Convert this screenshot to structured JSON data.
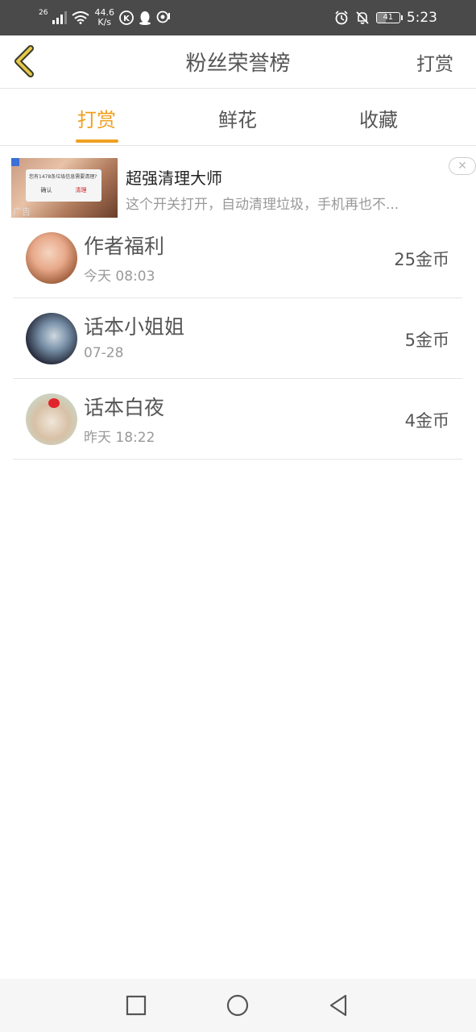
{
  "status_bar": {
    "network_type": "26",
    "speed_value": "44.6",
    "speed_unit": "K/s",
    "battery": "41",
    "time": "5:23"
  },
  "header": {
    "title": "粉丝荣誉榜",
    "right_action": "打赏"
  },
  "tabs": [
    {
      "label": "打赏",
      "active": true
    },
    {
      "label": "鲜花",
      "active": false
    },
    {
      "label": "收藏",
      "active": false
    }
  ],
  "ad": {
    "title": "超强清理大师",
    "description": "这个开关打开，自动清理垃圾，手机再也不...",
    "label": "广告",
    "image_dialog_text": "您有1478条垃圾信息需要清理?",
    "image_confirm": "确认",
    "image_clean": "清理",
    "close_icon": "close-icon"
  },
  "list": [
    {
      "name": "作者福利",
      "time": "今天 08:03",
      "amount": "25金币"
    },
    {
      "name": "话本小姐姐",
      "time": "07-28",
      "amount": "5金币"
    },
    {
      "name": "话本白夜",
      "time": "昨天 18:22",
      "amount": "4金币"
    }
  ],
  "colors": {
    "accent": "#f0a020",
    "status_bar_bg": "#4a4a4a",
    "back_arrow": "#e6c84a"
  },
  "nav_bar": {
    "icons": [
      "square-icon",
      "circle-icon",
      "triangle-back-icon"
    ]
  }
}
